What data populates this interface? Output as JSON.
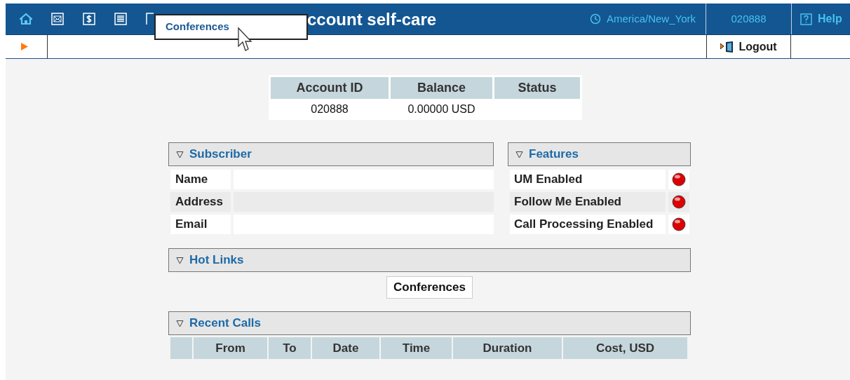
{
  "header": {
    "title": "ccount self-care",
    "timezone": "America/New_York",
    "account": "020888",
    "help": "Help"
  },
  "popup": {
    "label": "Conferences"
  },
  "logout": "Logout",
  "account_table": {
    "columns": [
      "Account ID",
      "Balance",
      "Status"
    ],
    "row": [
      "020888",
      "0.00000 USD"
    ]
  },
  "subscriber": {
    "title": "Subscriber",
    "expanded": true,
    "rows": [
      {
        "label": "Name"
      },
      {
        "label": "Address"
      },
      {
        "label": "Email"
      }
    ]
  },
  "features": {
    "title": "Features",
    "expanded": true,
    "items": [
      {
        "label": "UM Enabled",
        "on": false
      },
      {
        "label": "Follow Me Enabled",
        "on": false
      },
      {
        "label": "Call Processing Enabled",
        "on": false
      }
    ]
  },
  "hot_links": {
    "title": "Hot Links",
    "expanded": true,
    "buttons": [
      "Conferences"
    ]
  },
  "recent_calls": {
    "title": "Recent Calls",
    "expanded": true,
    "columns": [
      "From",
      "To",
      "Date",
      "Time",
      "Duration",
      "Cost, USD"
    ]
  }
}
